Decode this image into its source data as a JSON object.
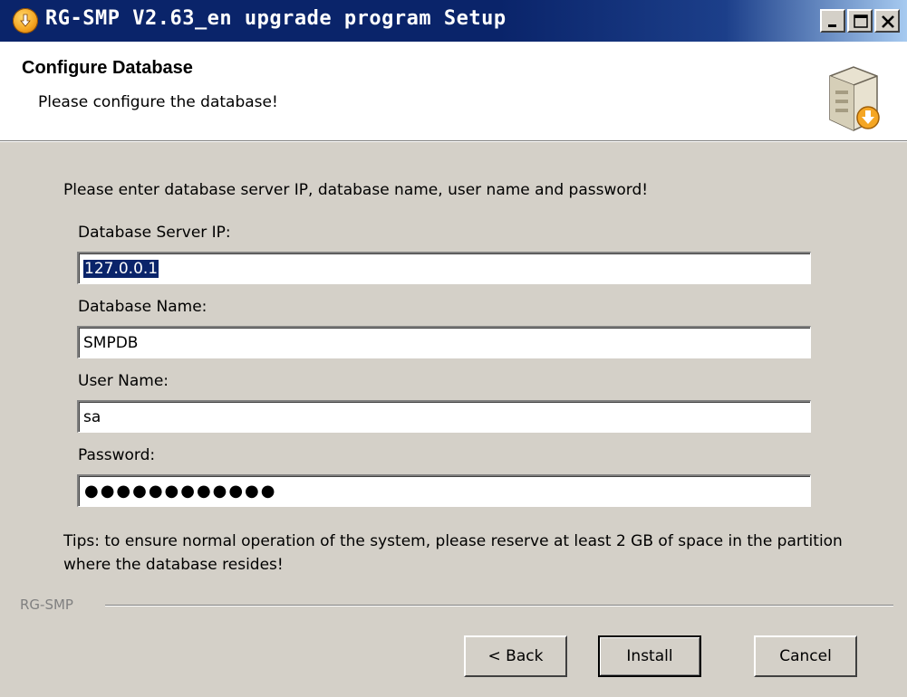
{
  "window": {
    "title": "RG-SMP V2.63_en upgrade program Setup",
    "title_icon": "installer-download-icon"
  },
  "titlebar_buttons": {
    "minimize_icon": "minimize-icon",
    "maximize_icon": "maximize-icon",
    "close_icon": "close-icon"
  },
  "header": {
    "title": "Configure Database",
    "subtitle": "Please configure the database!",
    "icon": "setup-box-icon"
  },
  "form": {
    "instruction": "Please enter database server IP, database name, user name and password!",
    "server_ip": {
      "label": "Database Server IP:",
      "value": "127.0.0.1"
    },
    "db_name": {
      "label": "Database Name:",
      "value": "SMPDB"
    },
    "user_name": {
      "label": "User Name:",
      "value": "sa"
    },
    "password": {
      "label": "Password:",
      "masked_value": "●●●●●●●●●●●●"
    }
  },
  "tips": "Tips: to ensure normal operation of the system, please reserve at least 2 GB of space in the partition where the database resides!",
  "brand": "RG-SMP",
  "buttons": {
    "back": "< Back",
    "install": "Install",
    "cancel": "Cancel"
  },
  "colors": {
    "titlebar": "#0a246a",
    "dialog_bg": "#d4d0c8",
    "selection": "#0a246a"
  }
}
